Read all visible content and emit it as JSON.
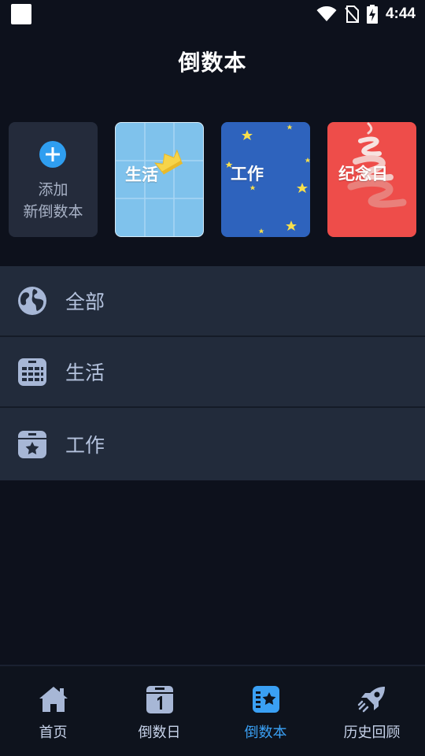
{
  "status_bar": {
    "time": "4:44"
  },
  "header": {
    "title": "倒数本"
  },
  "cards": {
    "add_line1": "添加",
    "add_line2": "新倒数本",
    "life": "生活",
    "work": "工作",
    "anniversary": "纪念日"
  },
  "list": [
    {
      "label": "全部",
      "icon": "globe-icon"
    },
    {
      "label": "生活",
      "icon": "calendar-grid-icon"
    },
    {
      "label": "工作",
      "icon": "calendar-star-icon"
    }
  ],
  "nav": [
    {
      "label": "首页",
      "icon": "home-icon"
    },
    {
      "label": "倒数日",
      "icon": "calendar-one-icon"
    },
    {
      "label": "倒数本",
      "icon": "notebook-star-icon",
      "active": true
    },
    {
      "label": "历史回顾",
      "icon": "rocket-icon"
    }
  ],
  "colors": {
    "accent": "#3aa0f4",
    "background": "#0d111c",
    "list_bg": "#222b3b"
  }
}
